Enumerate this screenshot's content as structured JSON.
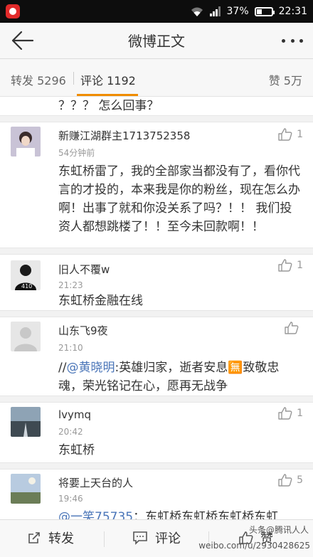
{
  "status_bar": {
    "battery": "37%",
    "time": "22:31",
    "battery_level": 0.37
  },
  "nav": {
    "title": "微博正文"
  },
  "tabs": {
    "repost": "转发 5296",
    "comment": "评论 1192",
    "like": "赞 5万"
  },
  "partial_text": "？？？ 怎么回事？",
  "comments": [
    {
      "name": "新赚江湖群主1713752358",
      "time": "54分钟前",
      "likes": "1",
      "text": "东虹桥雷了，我的全部家当都没有了，看你代言的才投的，本来我是你的粉丝，现在怎么办啊！出事了就和你没关系了吗？！！ 我们投资人都想跳楼了！！至今未回款啊！！"
    },
    {
      "name": "旧人不覆w",
      "time": "21:23",
      "likes": "1",
      "text": "东虹桥金融在线"
    },
    {
      "name": "山东飞9夜",
      "time": "21:10",
      "likes": "",
      "text_prefix": "//",
      "mention": "@黄晓明",
      "text": ":英雄归家，逝者安息🈚致敬忠魂，荣光铭记在心，愿再无战争"
    },
    {
      "name": "lvymq",
      "time": "20:42",
      "likes": "1",
      "text": "东虹桥"
    },
    {
      "name": "将要上天台的人",
      "time": "19:46",
      "likes": "5",
      "mention": "@一笑75735",
      "text": "：东虹桥东虹桥东虹桥东虹"
    }
  ],
  "bottom": {
    "repost": "转发",
    "comment": "评论",
    "like": "赞"
  },
  "watermark": {
    "line1": "头条@腾讯人人",
    "line2": "weibo.com/u/2930428625"
  },
  "icons": {
    "back": "arrow-left-icon",
    "more": "more-dots-icon",
    "like": "thumbs-up-icon",
    "repost": "repost-icon",
    "comment": "comment-icon"
  },
  "colors": {
    "accent": "#f08c00",
    "mention": "#4a75b8"
  }
}
